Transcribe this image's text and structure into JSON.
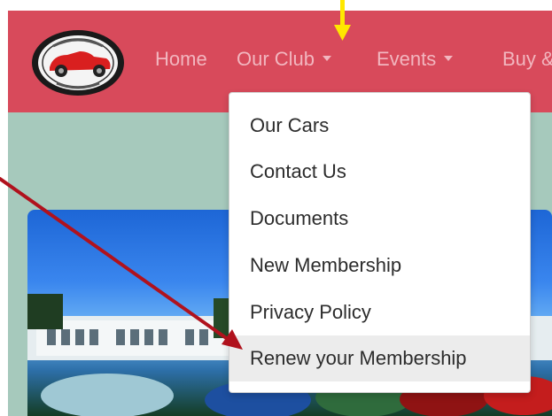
{
  "colors": {
    "navbar": "#d84a5b",
    "nav_link": "#f2b6bf",
    "page_background": "#a6c9bc",
    "dropdown_background": "#ffffff",
    "hover_background": "#ececec",
    "pointer_arrow": "#b0121d",
    "marker_arrow": "#ffe800"
  },
  "navbar": {
    "logo_icon": "car-club-logo-icon",
    "links": {
      "home": "Home",
      "our_club": "Our Club",
      "events": "Events",
      "buy": "Buy &"
    },
    "caret_icon": "caret-down-icon"
  },
  "dropdown": {
    "open_menu": "Our Club",
    "items": [
      {
        "label": "Our Cars"
      },
      {
        "label": "Contact Us"
      },
      {
        "label": "Documents"
      },
      {
        "label": "New Membership"
      },
      {
        "label": "Privacy Policy"
      },
      {
        "label": "Renew your Membership"
      }
    ],
    "highlighted_item": "Renew your Membership"
  },
  "annotations": {
    "marker_arrow_icon": "yellow-arrow-icon",
    "pointer_arrow_icon": "red-arrow-icon"
  }
}
